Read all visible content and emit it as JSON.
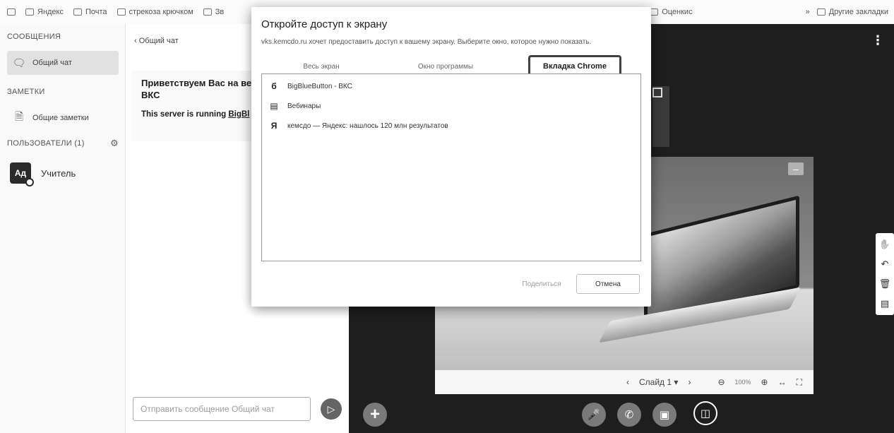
{
  "bookmarks": {
    "items": [
      {
        "label": "Яндекс"
      },
      {
        "label": "Почта"
      },
      {
        "label": "стрекоза крючком"
      },
      {
        "label": "Зв"
      }
    ],
    "right_items": [
      {
        "label": "Оценкис"
      },
      {
        "label": "Другие закладки"
      }
    ],
    "overflow_label": "»"
  },
  "sidebar": {
    "messages_header": "СООБЩЕНИЯ",
    "public_chat_label": "Общий чат",
    "notes_header": "ЗАМЕТКИ",
    "shared_notes_label": "Общие заметки",
    "users_header": "ПОЛЬЗОВАТЕЛИ (1)",
    "user": {
      "name": "Учитель",
      "avatar_text": "Ад"
    }
  },
  "chat": {
    "back_label": "Общий чат",
    "welcome": "Приветствуем Вас на веб",
    "welcome_line2": "ВКС",
    "server_prefix": "This server is running ",
    "server_link": "BigBl",
    "input_placeholder": "Отправить сообщение Общий чат"
  },
  "presentation": {
    "slide_label": "Слайд 1",
    "zoom": "100%"
  },
  "dialog": {
    "title": "Откройте доступ к экрану",
    "subtitle": "vks.kemcdo.ru хочет предоставить доступ к вашему экрану. Выберите окно, которое нужно показать.",
    "tabs": [
      "Весь экран",
      "Окно программы",
      "Вкладка Chrome"
    ],
    "active_tab": "Вкладка Chrome",
    "items": [
      {
        "label": "BigBlueButton - ВКС",
        "icon": "bigbluebutton-icon"
      },
      {
        "label": "Вебинары",
        "icon": "document-icon"
      },
      {
        "label": "кемсдо — Яндекс: нашлось 120 млн результатов",
        "icon": "yandex-icon"
      }
    ],
    "share_label": "Поделиться",
    "cancel_label": "Отмена"
  }
}
